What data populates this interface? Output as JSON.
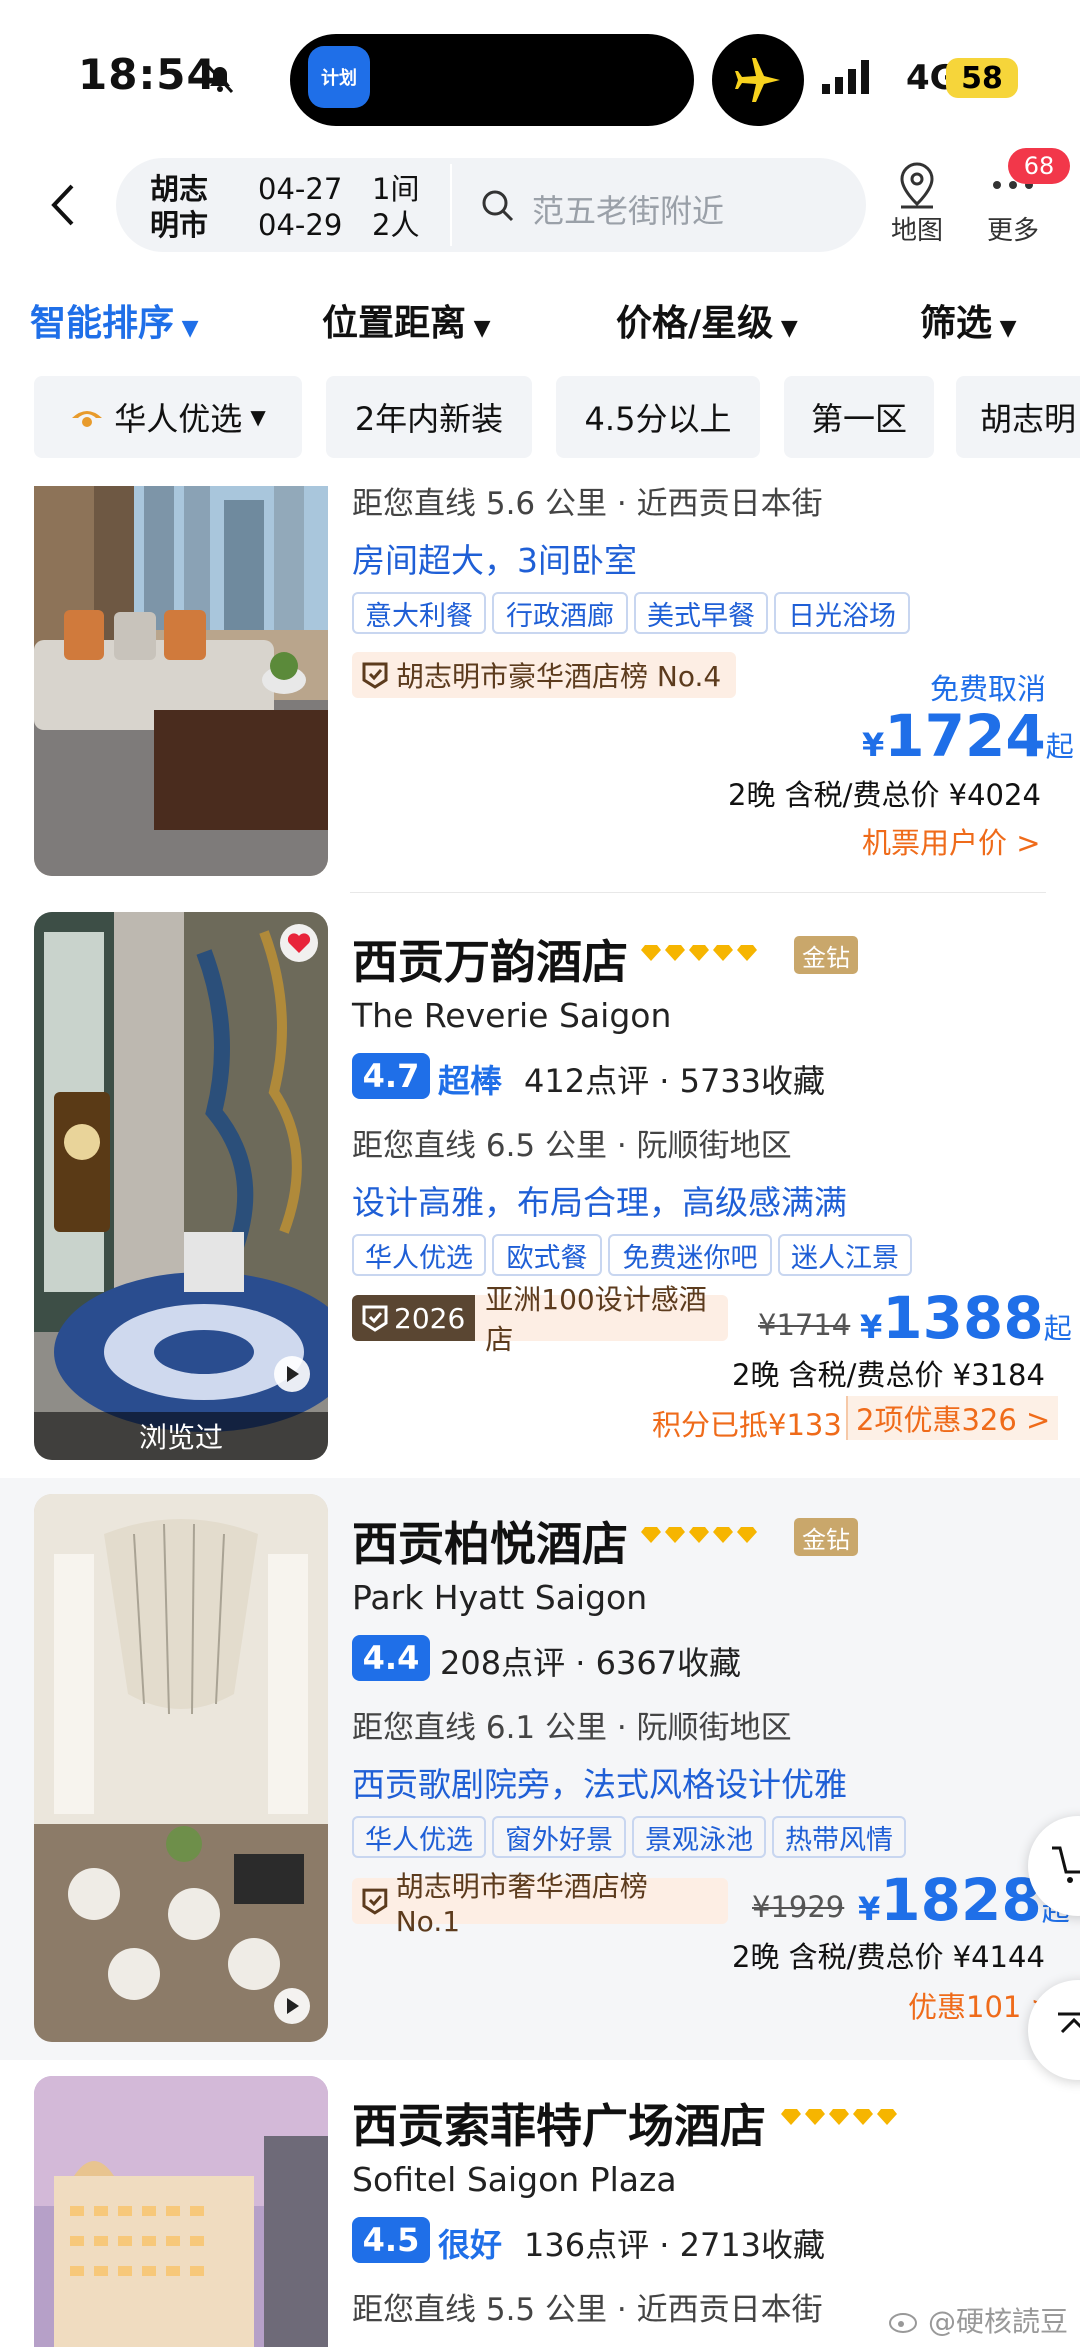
{
  "status": {
    "time": "18:54",
    "island_app": "计划",
    "network": "4G",
    "battery": "58"
  },
  "header": {
    "city": "胡志明市",
    "checkin": "04-27",
    "checkout": "04-29",
    "rooms": "1间",
    "guests": "2人",
    "search_placeholder": "范五老街附近",
    "map_label": "地图",
    "more_label": "更多",
    "more_badge": "68"
  },
  "sort": [
    "智能排序",
    "位置距离",
    "价格/星级",
    "筛选"
  ],
  "chips": [
    "华人优选",
    "2年内新装",
    "4.5分以上",
    "第一区",
    "胡志明"
  ],
  "colors": {
    "brand_blue": "#1f6fe8",
    "orange": "#ef6b1a",
    "star_gold": "#f6b500"
  },
  "hotels": [
    {
      "distance": "距您直线 5.6 公里 · 近西贡日本街",
      "slogan": "房间超大，3间卧室",
      "tags": [
        "意大利餐",
        "行政酒廊",
        "美式早餐",
        "日光浴场"
      ],
      "rank": "胡志明市豪华酒店榜 No.4",
      "free_cancel": "免费取消",
      "price": "1724",
      "price_prefix": "¥",
      "price_suffix": "起",
      "total": "2晚 含税/费总价 ¥4024",
      "promo": "机票用户价 >"
    },
    {
      "name": "西贡万韵酒店",
      "name_en": "The Reverie Saigon",
      "diamond": "金钻",
      "score": "4.7",
      "score_word": "超棒",
      "reviews": "412点评 · 5733收藏",
      "distance": "距您直线 6.5 公里 · 阮顺街地区",
      "slogan": "设计高雅，布局合理，高级感满满",
      "tags": [
        "华人优选",
        "欧式餐",
        "免费迷你吧",
        "迷人江景"
      ],
      "rank_year": "2026",
      "rank": "亚洲100设计感酒店",
      "old_price": "¥1714",
      "price": "1388",
      "price_prefix": "¥",
      "price_suffix": "起",
      "total": "2晚 含税/费总价 ¥3184",
      "promo_a": "积分已抵¥133",
      "promo_b": "2项优惠326 >",
      "viewed": "浏览过"
    },
    {
      "name": "西贡柏悦酒店",
      "name_en": "Park Hyatt Saigon",
      "diamond": "金钻",
      "score": "4.4",
      "reviews": "208点评 · 6367收藏",
      "distance": "距您直线 6.1 公里 · 阮顺街地区",
      "slogan": "西贡歌剧院旁，法式风格设计优雅",
      "tags": [
        "华人优选",
        "窗外好景",
        "景观泳池",
        "热带风情"
      ],
      "rank": "胡志明市奢华酒店榜 No.1",
      "old_price": "¥1929",
      "price": "1828",
      "price_prefix": "¥",
      "price_suffix": "起",
      "total": "2晚 含税/费总价 ¥4144",
      "promo": "优惠101 >"
    },
    {
      "name": "西贡索菲特广场酒店",
      "name_en": "Sofitel Saigon Plaza",
      "score": "4.5",
      "score_word": "很好",
      "reviews": "136点评 · 2713收藏",
      "distance": "距您直线 5.5 公里 · 近西贡日本街"
    }
  ],
  "watermark": "@硬核読豆"
}
